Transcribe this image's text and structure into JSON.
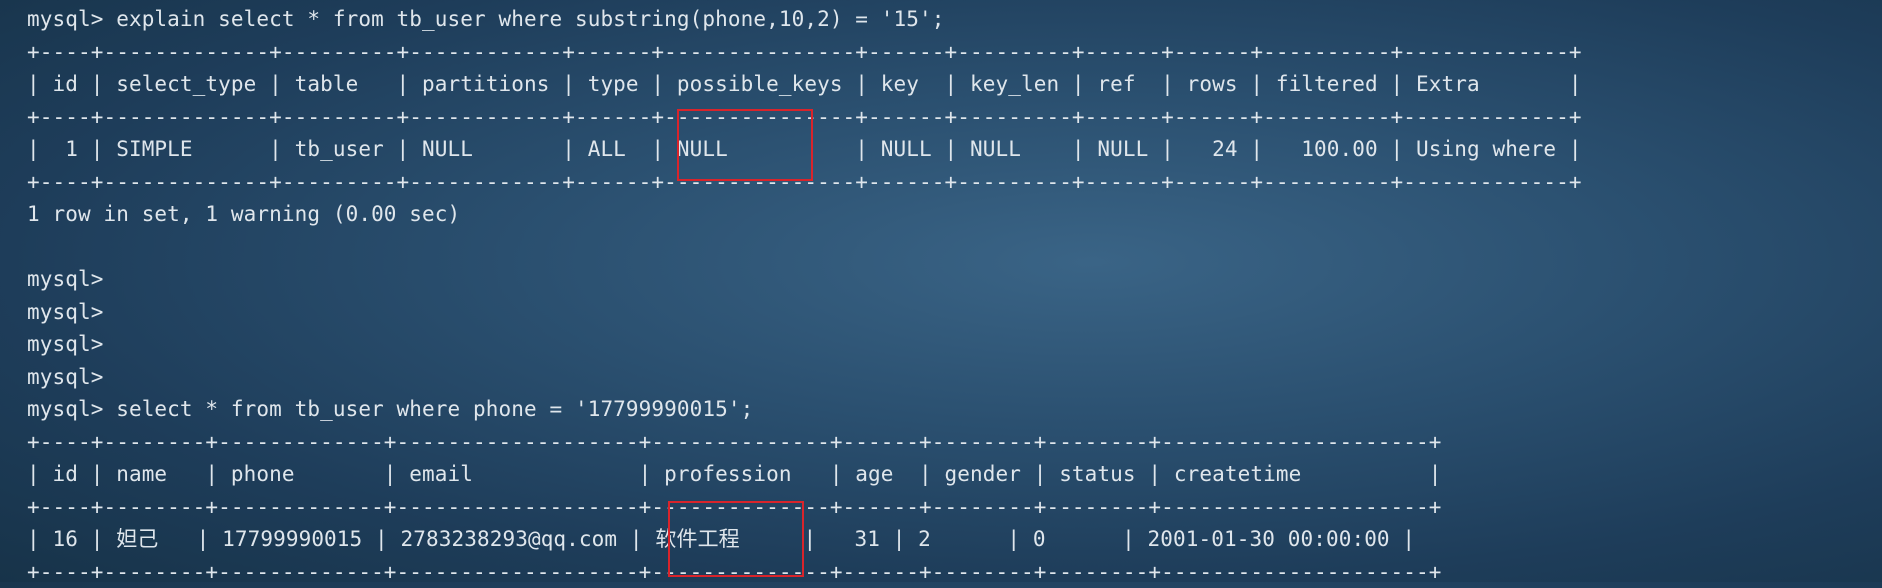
{
  "terminal": {
    "lines": [
      "mysql> explain select * from tb_user where substring(phone,10,2) = '15';",
      "+----+-------------+---------+------------+------+---------------+------+---------+------+------+----------+-------------+",
      "| id | select_type | table   | partitions | type | possible_keys | key  | key_len | ref  | rows | filtered | Extra       |",
      "+----+-------------+---------+------------+------+---------------+------+---------+------+------+----------+-------------+",
      "|  1 | SIMPLE      | tb_user | NULL       | ALL  | NULL          | NULL | NULL    | NULL |   24 |   100.00 | Using where |",
      "+----+-------------+---------+------------+------+---------------+------+---------+------+------+----------+-------------+",
      "1 row in set, 1 warning (0.00 sec)",
      "",
      "mysql>",
      "mysql>",
      "mysql>",
      "mysql>",
      "mysql> select * from tb_user where phone = '17799990015';",
      "+----+--------+-------------+-------------------+--------------+------+--------+--------+---------------------+",
      "| id | name   | phone       | email             | profession   | age  | gender | status | createtime          |",
      "+----+--------+-------------+-------------------+--------------+------+--------+--------+---------------------+",
      "| 16 | 妲己   | 17799990015 | 2783238293@qq.com | 软件工程     |   31 | 2      | 0      | 2001-01-30 00:00:00 |",
      "+----+--------+-------------+-------------------+--------------+------+--------+--------+---------------------+"
    ]
  },
  "annotation_color": "#d9242b"
}
